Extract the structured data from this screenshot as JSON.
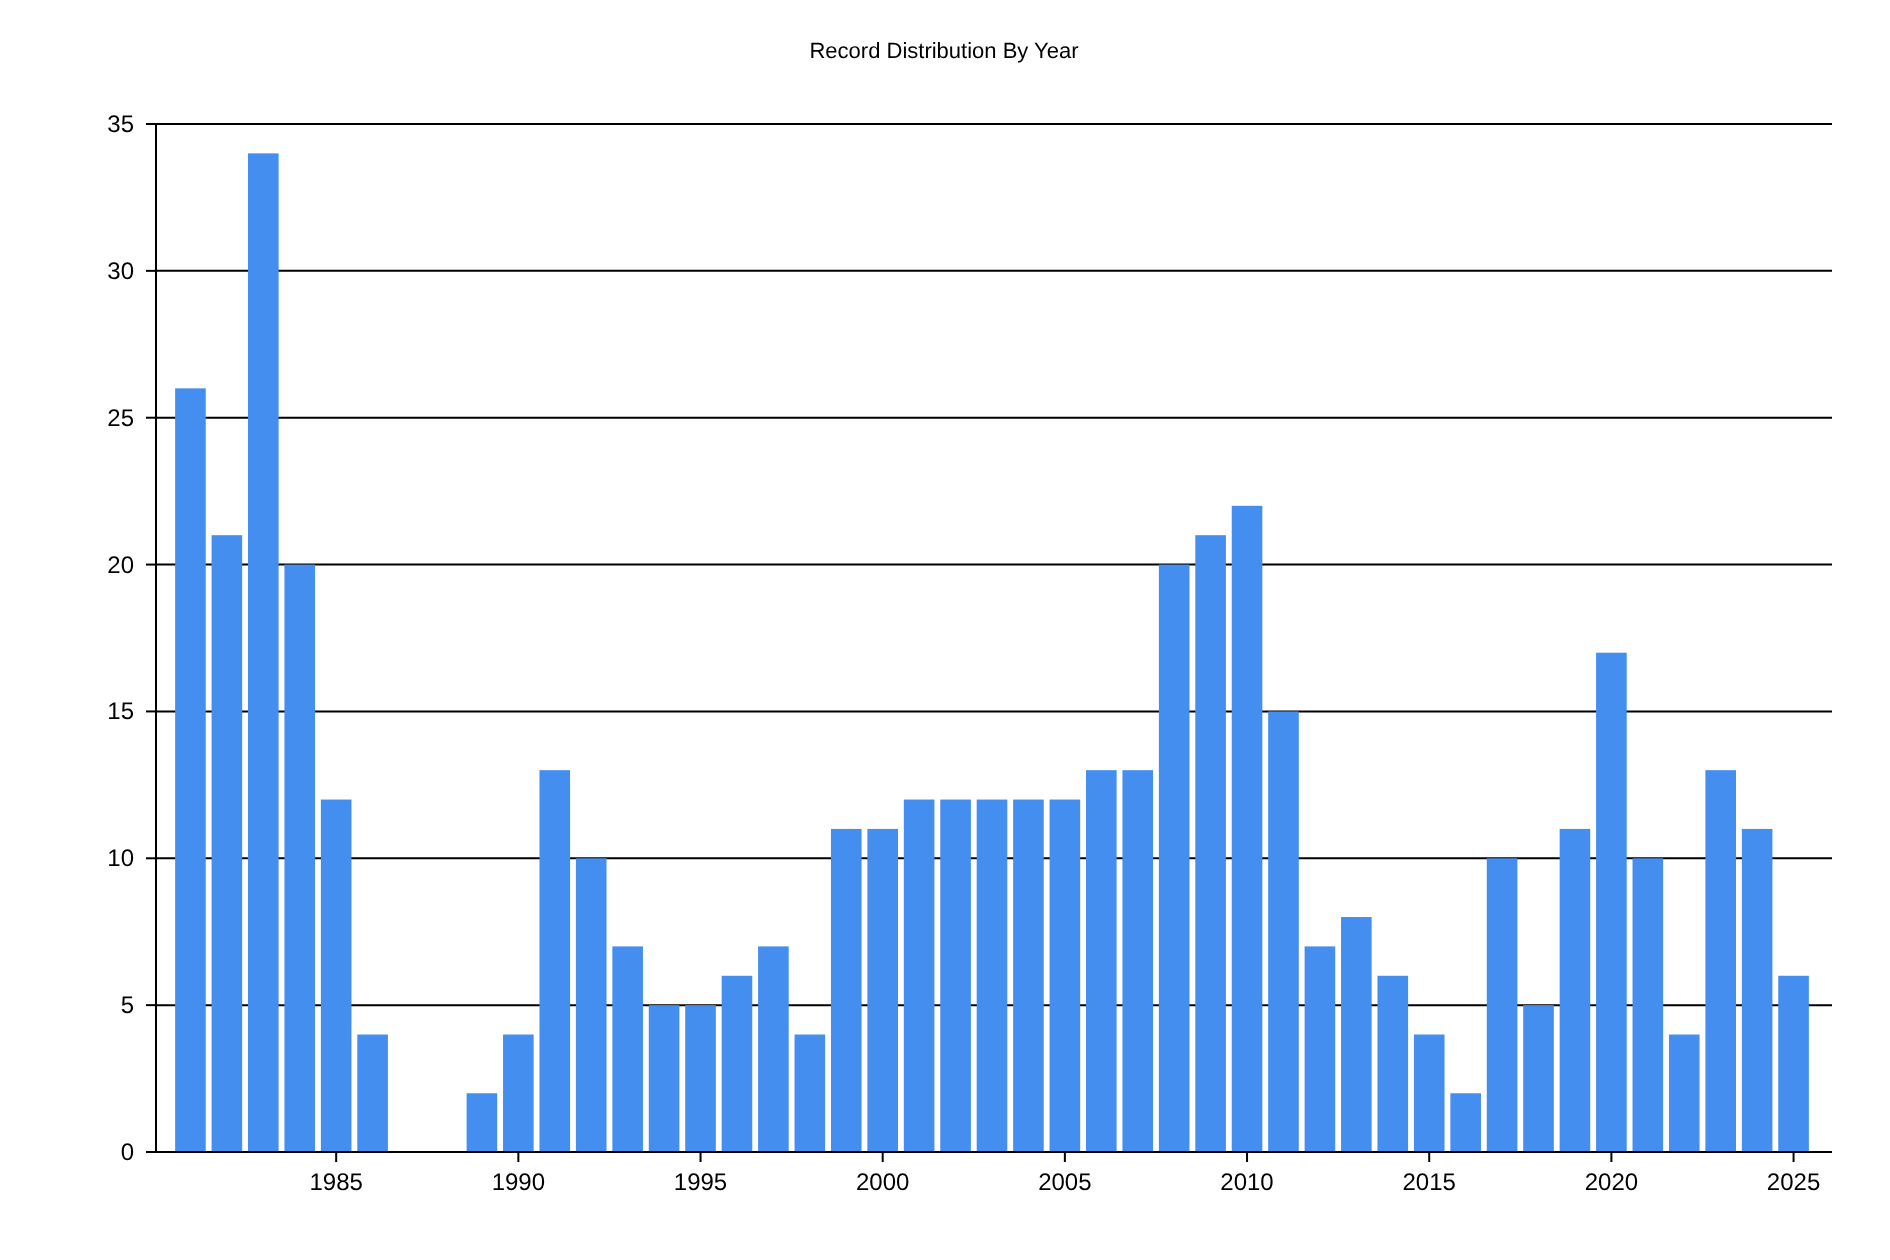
{
  "chart_data": {
    "type": "bar",
    "title": "Record Distribution By Year",
    "x": [
      1981,
      1982,
      1983,
      1984,
      1985,
      1986,
      1987,
      1988,
      1989,
      1990,
      1991,
      1992,
      1993,
      1994,
      1995,
      1996,
      1997,
      1998,
      1999,
      2000,
      2001,
      2002,
      2003,
      2004,
      2005,
      2006,
      2007,
      2008,
      2009,
      2010,
      2011,
      2012,
      2013,
      2014,
      2015,
      2016,
      2017,
      2018,
      2019,
      2020,
      2021,
      2022,
      2023,
      2024,
      2025
    ],
    "values": [
      26,
      21,
      34,
      20,
      12,
      4,
      0,
      0,
      2,
      4,
      13,
      10,
      7,
      5,
      5,
      6,
      7,
      4,
      11,
      11,
      12,
      12,
      12,
      12,
      12,
      13,
      13,
      20,
      21,
      22,
      15,
      7,
      8,
      6,
      4,
      2,
      10,
      5,
      11,
      17,
      10,
      4,
      13,
      11,
      6
    ],
    "ylim": [
      0,
      35
    ],
    "yticks": [
      0,
      5,
      10,
      15,
      20,
      25,
      30,
      35
    ],
    "xlim": [
      1980,
      2026
    ],
    "xticks": [
      1985,
      1990,
      1995,
      2000,
      2005,
      2010,
      2015,
      2020,
      2025
    ],
    "grid": true
  }
}
